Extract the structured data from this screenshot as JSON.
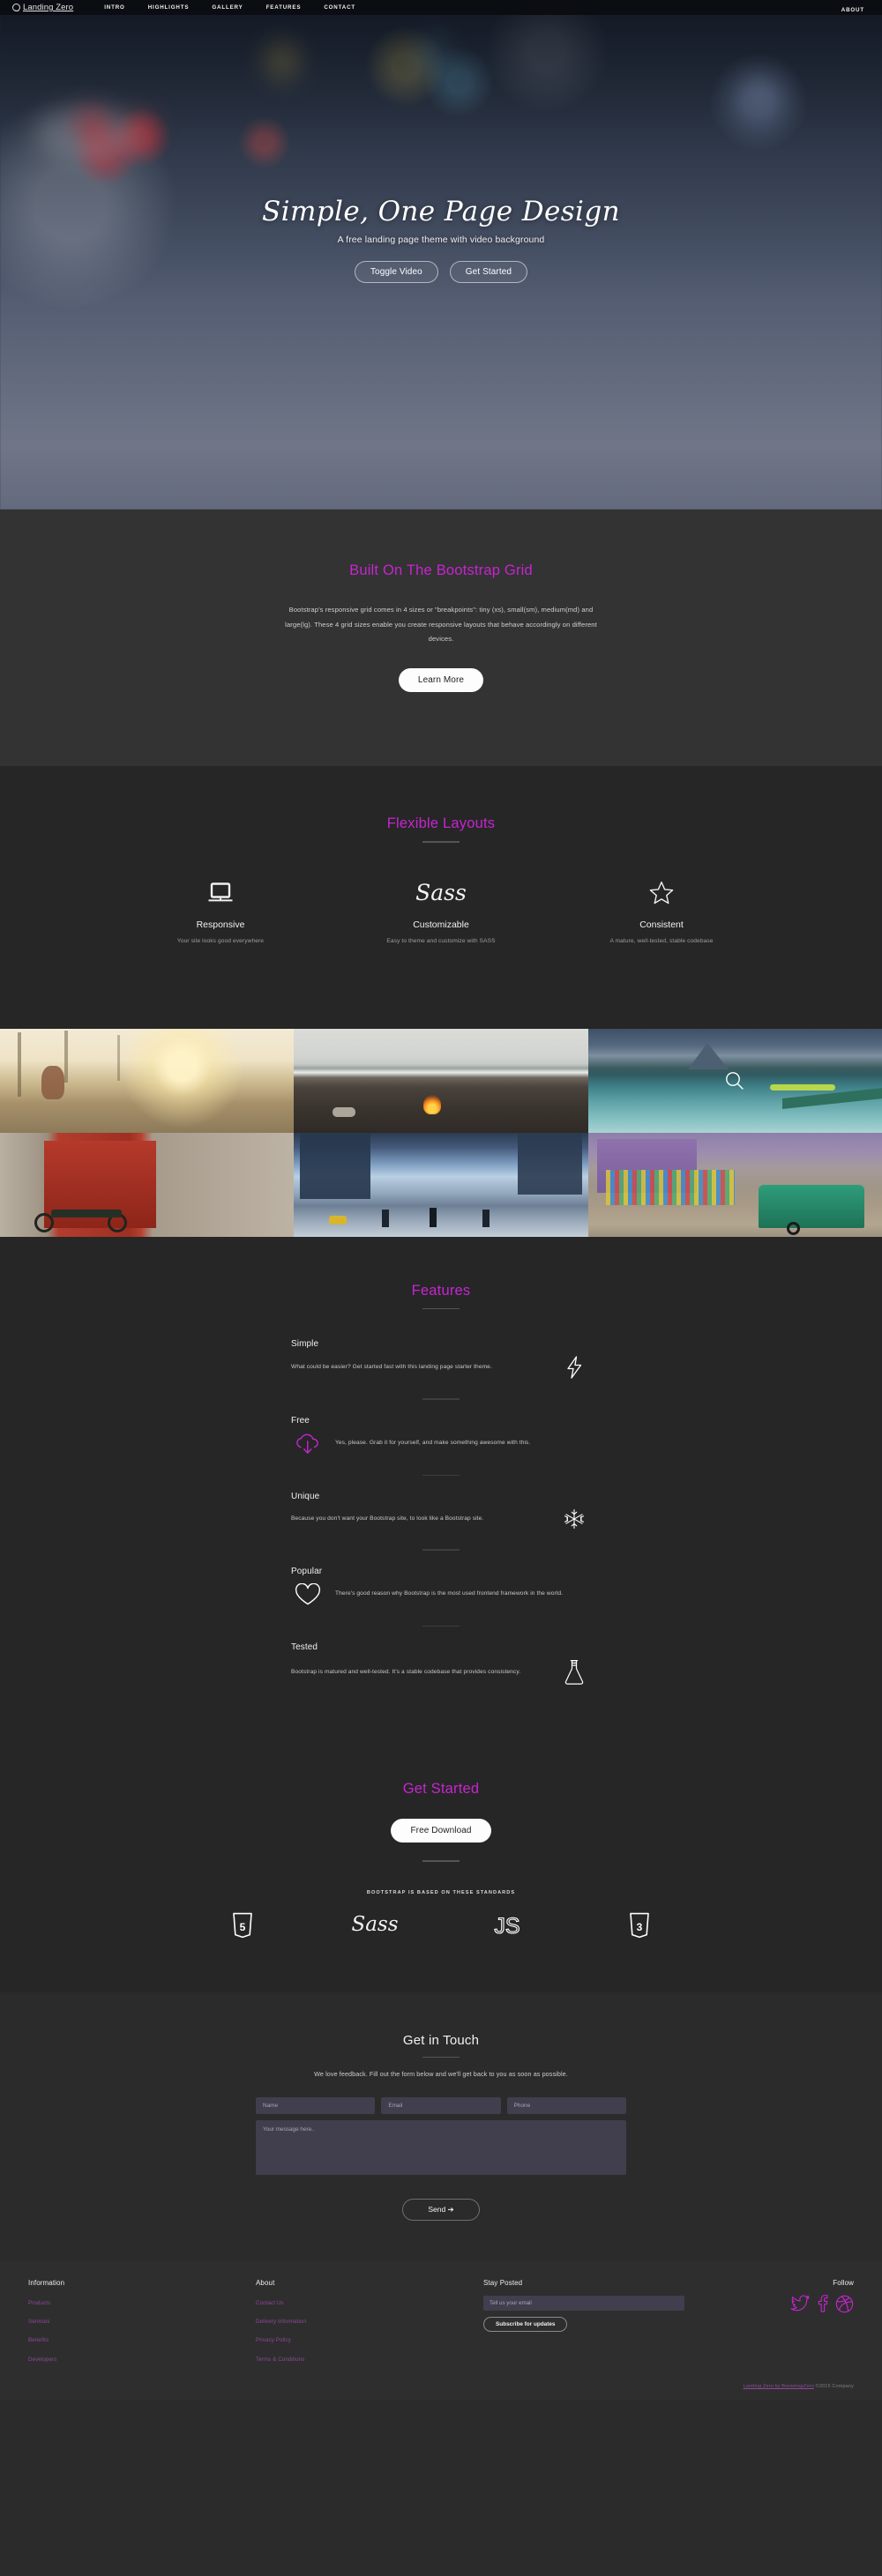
{
  "navbar": {
    "brand": "Landing Zero",
    "brand_icon": "smiley-outline-icon",
    "links": [
      {
        "label": "INTRO"
      },
      {
        "label": "HIGHLIGHTS"
      },
      {
        "label": "GALLERY"
      },
      {
        "label": "FEATURES"
      },
      {
        "label": "CONTACT"
      }
    ],
    "right_link": "ABOUT"
  },
  "hero": {
    "title": "Simple, One Page Design",
    "subtitle": "A free landing page theme with video background",
    "button_primary": "Toggle Video",
    "button_secondary": "Get Started"
  },
  "grid_section": {
    "heading": "Built On The Bootstrap Grid",
    "body": "Bootstrap's responsive grid comes in 4 sizes or \"breakpoints\": tiny (xs), small(sm), medium(md) and large(lg). These 4 grid sizes enable you create responsive layouts that behave accordingly on different devices.",
    "button": "Learn More"
  },
  "flexible": {
    "heading": "Flexible Layouts",
    "columns": [
      {
        "icon": "laptop-icon",
        "title": "Responsive",
        "text": "Your site looks good everywhere"
      },
      {
        "icon": "sass-logo-icon",
        "title": "Customizable",
        "text": "Easy to theme and customize with SASS"
      },
      {
        "icon": "star-outline-icon",
        "title": "Consistent",
        "text": "A mature, well-tested, stable codebase"
      }
    ]
  },
  "gallery": {
    "tiles": [
      {
        "name": "deer-in-forest-at-sunrise",
        "overlay_icon": null
      },
      {
        "name": "beach-campfire-by-the-sea",
        "overlay_icon": null
      },
      {
        "name": "mountain-lake-with-dock",
        "overlay_icon": "magnifier-icon"
      },
      {
        "name": "motorbike-against-red-door",
        "overlay_icon": null
      },
      {
        "name": "city-street-crosswalk",
        "overlay_icon": null
      },
      {
        "name": "market-street-with-rickshaw",
        "overlay_icon": null
      }
    ]
  },
  "features": {
    "heading": "Features",
    "items": [
      {
        "title": "Simple",
        "text": "What could be easier? Get started fast with this landing page starter theme.",
        "icon": "lightning-bolt-icon",
        "icon_side": "right",
        "icon_color": "#ffffff"
      },
      {
        "title": "Free",
        "text": "Yes, please. Grab it for yourself, and make something awesome with this.",
        "icon": "cloud-download-icon",
        "icon_side": "left",
        "icon_color": "#c724d1"
      },
      {
        "title": "Unique",
        "text": "Because you don't want your Bootstrap site, to look like a Bootstrap site.",
        "icon": "snowflake-icon",
        "icon_side": "right",
        "icon_color": "#ffffff"
      },
      {
        "title": "Popular",
        "text": "There's good reason why Bootstrap is the most used frontend framework in the world.",
        "icon": "heart-outline-icon",
        "icon_side": "left",
        "icon_color": "#ffffff"
      },
      {
        "title": "Tested",
        "text": "Bootstrap is matured and well-tested. It's a stable codebase that provides consistency.",
        "icon": "flask-icon",
        "icon_side": "right",
        "icon_color": "#ffffff"
      }
    ]
  },
  "get_started": {
    "heading": "Get Started",
    "button": "Free Download",
    "standards_label": "BOOTSTRAP IS BASED ON THESE STANDARDS",
    "standards": [
      {
        "name": "html5-shield-icon"
      },
      {
        "name": "sass-logo-icon"
      },
      {
        "name": "javascript-js-icon"
      },
      {
        "name": "css3-shield-icon"
      }
    ]
  },
  "contact": {
    "heading": "Get in Touch",
    "subtitle": "We love feedback. Fill out the form below and we'll get back to you as soon as possible.",
    "name_placeholder": "Name",
    "email_placeholder": "Email",
    "phone_placeholder": "Phone",
    "message_placeholder": "Your message here..",
    "name_value": "",
    "email_value": "",
    "phone_value": "",
    "message_value": "",
    "submit": "Send ➔"
  },
  "footer": {
    "information": {
      "title": "Information",
      "links": [
        "Products",
        "Services",
        "Benefits",
        "Developers"
      ]
    },
    "about": {
      "title": "About",
      "links": [
        "Contact Us",
        "Delivery Information",
        "Privacy Policy",
        "Terms & Conditions"
      ]
    },
    "stay_posted": {
      "title": "Stay Posted",
      "email_placeholder": "Tell us your email",
      "email_value": "",
      "button": "Subscribe for updates"
    },
    "follow": {
      "title": "Follow",
      "socials": [
        "twitter-bird-icon",
        "facebook-f-icon",
        "dribbble-ball-icon"
      ]
    },
    "copyright_link": "Landing Zero by BootstrapZero",
    "copyright_rest": " ©2015 Company"
  },
  "colors": {
    "accent": "#c724d1",
    "footer_link": "#8d4a99",
    "bg_dark": "#262626",
    "bg_grid": "#333333",
    "bg_contact": "#2b2b2b",
    "input_bg": "#413e4e"
  }
}
